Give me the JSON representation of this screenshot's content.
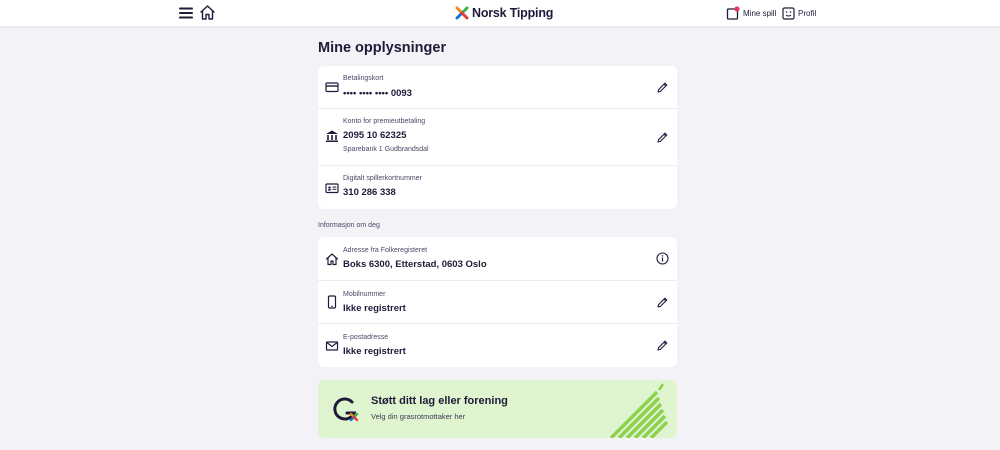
{
  "header": {
    "brand": "Norsk Tipping",
    "mine_spill": "Mine spill",
    "profil": "Profil",
    "brand_colors": {
      "orange": "#f28a1e",
      "green": "#3fae49",
      "blue": "#1f6fd1",
      "red": "#e23c3c"
    }
  },
  "page": {
    "title": "Mine opplysninger"
  },
  "payment": {
    "items": [
      {
        "icon": "credit-card-icon",
        "label": "Betalingskort",
        "value": "•••• •••• •••• 0093",
        "action": "pencil-icon"
      },
      {
        "icon": "bank-icon",
        "label": "Konto for premieutbetaling",
        "value": "2095 10 62325",
        "sub": "Sparebank 1 Gudbrandsdal",
        "action": "pencil-icon"
      },
      {
        "icon": "id-card-icon",
        "label": "Digitalt spillerkortnummer",
        "value": "310 286 338"
      }
    ]
  },
  "info": {
    "section_label": "Informasjon om deg",
    "items": [
      {
        "icon": "house-icon",
        "label": "Adresse fra Folkeregisteret",
        "value": "Boks 6300, Etterstad, 0603 Oslo",
        "action": "info-icon"
      },
      {
        "icon": "phone-icon",
        "label": "Mobilnummer",
        "value": "Ikke registrert",
        "action": "pencil-icon"
      },
      {
        "icon": "envelope-icon",
        "label": "E-postadresse",
        "value": "Ikke registrert",
        "action": "pencil-icon"
      }
    ]
  },
  "grasrot": {
    "title": "Støtt ditt lag eller forening",
    "subtitle": "Velg din grasrotmottaker her",
    "background": "#dff5cf",
    "accent": "#8fd14f"
  }
}
